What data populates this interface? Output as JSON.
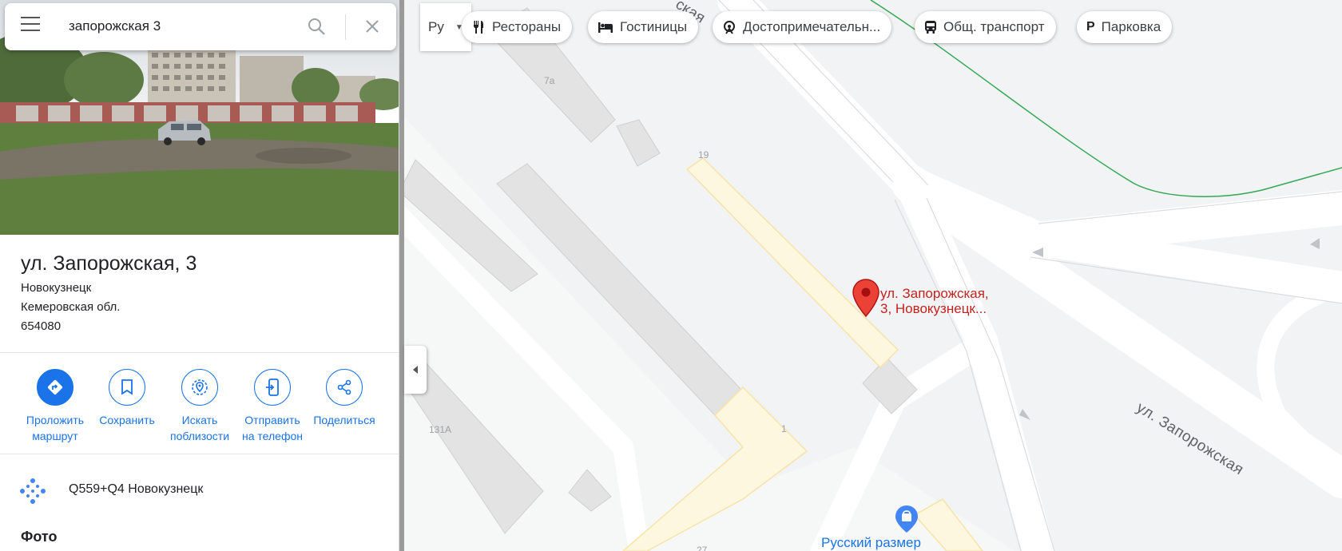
{
  "search": {
    "value": "запорожская 3"
  },
  "place": {
    "title": "ул. Запорожская, 3",
    "address_lines": [
      "Новокузнецк",
      "Кемеровская обл.",
      "654080"
    ]
  },
  "actions": [
    {
      "label": "Проложить\nмаршрут",
      "icon": "directions-icon"
    },
    {
      "label": "Сохранить",
      "icon": "bookmark-icon"
    },
    {
      "label": "Искать\nпоблизости",
      "icon": "nearby-icon"
    },
    {
      "label": "Отправить\nна телефон",
      "icon": "send-to-phone-icon"
    },
    {
      "label": "Поделиться",
      "icon": "share-icon"
    }
  ],
  "plus_code": "Q559+Q4 Новокузнецк",
  "photos_heading": "Фото",
  "map": {
    "layer_label": "Ру",
    "chips": [
      {
        "label": "Рестораны",
        "icon": "restaurant-icon"
      },
      {
        "label": "Гостиницы",
        "icon": "hotel-icon"
      },
      {
        "label": "Достопримечательн...",
        "icon": "attractions-icon"
      },
      {
        "label": "Общ. транспорт",
        "icon": "transit-icon"
      },
      {
        "label": "Парковка",
        "icon": "parking-icon"
      }
    ],
    "marker_label": [
      "ул. Запорожская,",
      "3, Новокузнецк..."
    ],
    "poi_label": "Русский размер",
    "street_name": "ул. Запорожская",
    "street_name_top": "ская",
    "building_numbers": [
      "7а",
      "19",
      "1",
      "131А",
      "27"
    ]
  },
  "colors": {
    "accent": "#1a73e8",
    "marker": "#ea4335",
    "marker_text": "#c5221f",
    "green_line": "#34a853"
  }
}
